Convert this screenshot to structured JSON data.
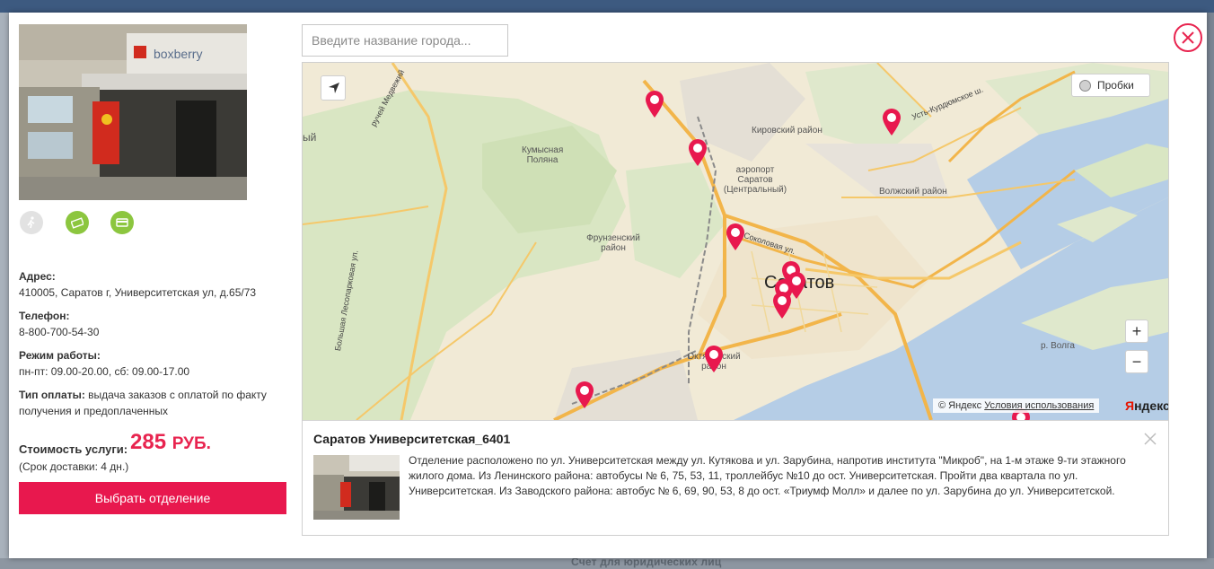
{
  "background_page": {
    "footer_link": "Счет для юридических лиц"
  },
  "modal": {
    "close_icon": "close-circle-icon",
    "office": {
      "photo_brand": "boxberry",
      "features": [
        {
          "name": "pedestrian-icon",
          "enabled": false
        },
        {
          "name": "card-payment-icon",
          "enabled": true
        },
        {
          "name": "prepaid-icon",
          "enabled": true
        }
      ],
      "address_label": "Адрес:",
      "address": "410005, Саратов г, Университетская ул, д.65/73",
      "phone_label": "Телефон:",
      "phone": "8-800-700-54-30",
      "hours_label": "Режим работы:",
      "hours": "пн-пт: 09.00-20.00, сб: 09.00-17.00",
      "payment_label": "Тип оплаты:",
      "payment": "выдача заказов с оплатой по факту получения и предоплаченных",
      "cost_label": "Стоимость услуги:",
      "cost_value": "285",
      "cost_currency": "РУБ.",
      "delivery": "(Срок доставки: 4 дн.)",
      "select_button": "Выбрать отделение"
    },
    "search": {
      "placeholder": "Введите название города..."
    },
    "map": {
      "traffic_button": "Пробки",
      "zoom_in": "+",
      "zoom_out": "−",
      "copyright_prefix": "© Яндекс",
      "terms_link": "Условия использования",
      "logo_first": "Я",
      "logo_rest": "ндекс",
      "labels": {
        "city": "Саратов",
        "kirovsky": "Кировский район",
        "airport": "аэропорт Саратов (Центральный)",
        "kumysnaya": "Кумысная Поляна",
        "frunzensky": "Фрунзенский район",
        "volzhsky": "Волжский район",
        "oktyabrsky": "Октябрьский район",
        "sokolovaya": "Соколовая ул.",
        "ust_kurdyum": "Усть-Курдюмское ш.",
        "medvezhiy": "ручей Медвежий",
        "lesoparkovaya": "Большая Лесопарковая ул.",
        "volga": "р. Волга",
        "edge_left": "ый"
      }
    },
    "balloon": {
      "title": "Саратов Университетская_6401",
      "description": "Отделение расположено по ул. Университетская между ул. Кутякова и ул. Зарубина, напротив института \"Микроб\", на 1-м этаже 9-ти этажного жилого дома. Из Ленинского района: автобусы № 6, 75, 53, 11, троллейбус №10 до ост. Университетская. Пройти два квартала по ул. Университетская. Из Заводского района: автобус № 6, 69, 90, 53, 8 до ост. «Триумф Молл» и далее по ул. Зарубина до ул. Университетской."
    },
    "colors": {
      "accent": "#e8184e",
      "feature_green": "#8cc63f",
      "map_land": "#f1ead6",
      "map_water": "#b5cde6",
      "map_forest": "#d9e6c3"
    }
  }
}
